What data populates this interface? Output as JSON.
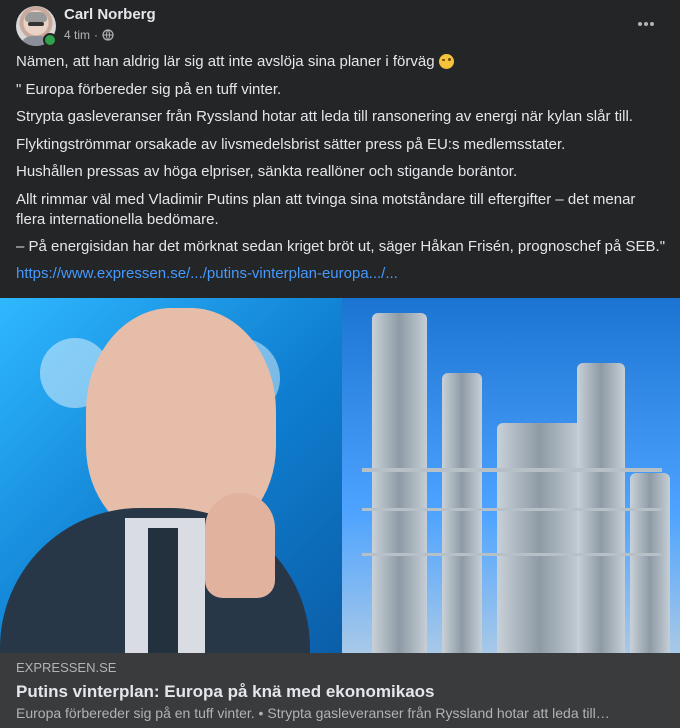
{
  "post": {
    "author": "Carl Norberg",
    "time": "4 tim",
    "separator": "·",
    "lines": [
      "Nämen, att han aldrig lär sig att inte avslöja sina planer i förväg",
      "\" Europa förbereder sig på en tuff vinter.",
      " Strypta gasleveranser från Ryssland hotar att leda till ransonering av energi när kylan slår till.",
      " Flyktingströmmar orsakade av livsmedelsbrist sätter press på EU:s medlemsstater.",
      " Hushållen pressas av höga elpriser, sänkta reallöner och stigande boräntor.",
      "Allt rimmar väl med Vladimir Putins plan att tvinga sina motståndare till eftergifter – det menar flera internationella bedömare.",
      "– På energisidan har det mörknat sedan kriget bröt ut, säger Håkan Frisén, prognoschef på SEB.\""
    ],
    "link": "https://www.expressen.se/.../putins-vinterplan-europa.../...",
    "emoji": "winking-face"
  },
  "preview": {
    "domain": "EXPRESSEN.SE",
    "title": "Putins vinterplan: Europa på knä med ekonomikaos",
    "description": "Europa förbereder sig på en tuff vinter. • Strypta gasleveranser från Ryssland hotar att leda till…"
  },
  "colors": {
    "background": "#242526",
    "text": "#e4e6eb",
    "secondary_text": "#b0b3b8",
    "link": "#4599ff",
    "online": "#31a24c",
    "preview_background": "#3a3b3c"
  }
}
